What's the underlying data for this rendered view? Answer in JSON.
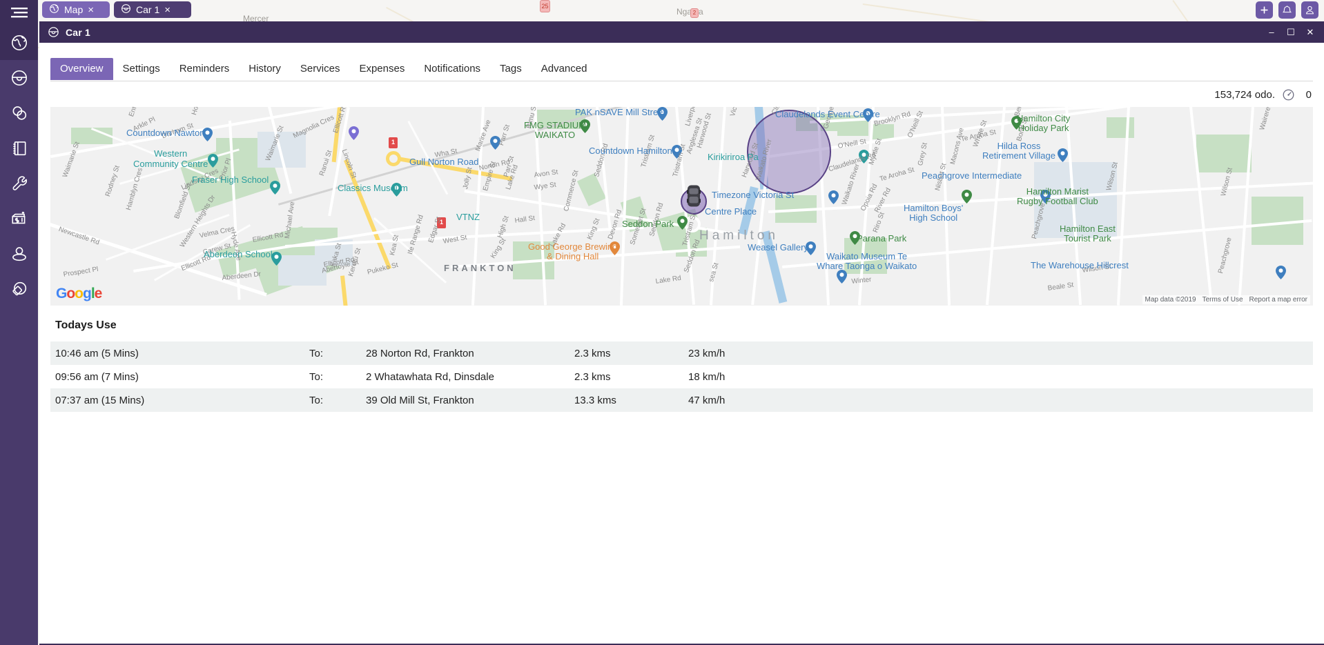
{
  "tabstrip": {
    "tabs": [
      {
        "label": "Map",
        "icon": "globe-icon",
        "close": "×",
        "active": true
      },
      {
        "label": "Car 1",
        "icon": "steering-wheel-icon",
        "close": "×",
        "active": false
      }
    ]
  },
  "topright": {
    "buttons": [
      {
        "name": "add-button",
        "icon": "plus-icon"
      },
      {
        "name": "notifications-button",
        "icon": "bell-icon"
      },
      {
        "name": "account-button",
        "icon": "user-icon"
      }
    ]
  },
  "rail": {
    "menu_icon": "hamburger-menu-icon",
    "items": [
      {
        "icon": "globe-icon",
        "name": "sidebar-item-map",
        "active": true
      },
      {
        "icon": "steering-wheel-icon",
        "name": "sidebar-item-vehicles",
        "active": false
      },
      {
        "icon": "circles-icon",
        "name": "sidebar-item-groups",
        "active": false
      },
      {
        "icon": "notebook-icon",
        "name": "sidebar-item-logbook",
        "active": false
      },
      {
        "icon": "wrench-icon",
        "name": "sidebar-item-services",
        "active": false
      },
      {
        "icon": "money-icon",
        "name": "sidebar-item-expenses",
        "active": false
      },
      {
        "icon": "person-pin-icon",
        "name": "sidebar-item-drivers",
        "active": false
      },
      {
        "icon": "tag-icon",
        "name": "sidebar-item-tags",
        "active": false
      }
    ]
  },
  "window": {
    "title": "Car 1",
    "title_icon": "steering-wheel-icon",
    "controls": {
      "minimize": "–",
      "maximize": "☐",
      "close": "✕"
    }
  },
  "nav": {
    "tabs": [
      {
        "label": "Overview",
        "active": true
      },
      {
        "label": "Settings",
        "active": false
      },
      {
        "label": "Reminders",
        "active": false
      },
      {
        "label": "History",
        "active": false
      },
      {
        "label": "Services",
        "active": false
      },
      {
        "label": "Expenses",
        "active": false
      },
      {
        "label": "Notifications",
        "active": false
      },
      {
        "label": "Tags",
        "active": false
      },
      {
        "label": "Advanced",
        "active": false
      }
    ]
  },
  "odometer": {
    "reading": "153,724 odo.",
    "gauge_icon": "speedometer-icon",
    "gauge_value": "0"
  },
  "map": {
    "provider_logo": "google-logo",
    "attribution": [
      "Map data ©2019",
      "Terms of Use",
      "Report a map error"
    ],
    "city_label": "Hamilton",
    "suburb_label": "FRANKTON",
    "vehicle_marker": "car-marker-icon",
    "geofence_label": "geofence-circle",
    "pois": [
      {
        "name": "Countdown Nawton",
        "kind": "blue"
      },
      {
        "name": "Western\nCommunity Centre",
        "kind": "teal"
      },
      {
        "name": "Fraser High School",
        "kind": "teal"
      },
      {
        "name": "Classics Museum",
        "kind": "teal"
      },
      {
        "name": "Aberdeen School",
        "kind": "teal"
      },
      {
        "name": "Gull Norton Road",
        "kind": "blue"
      },
      {
        "name": "VTNZ",
        "kind": "teal"
      },
      {
        "name": "PAK nSAVE Mill Street",
        "kind": "blue"
      },
      {
        "name": "FMG STADIUM\nWAIKATO",
        "kind": "green"
      },
      {
        "name": "Countdown Hamilton",
        "kind": "blue"
      },
      {
        "name": "Kirikiriroa Pa",
        "kind": "teal"
      },
      {
        "name": "Timezone Victoria St",
        "kind": "blue"
      },
      {
        "name": "Centre Place",
        "kind": "blue"
      },
      {
        "name": "Seddon Park",
        "kind": "green"
      },
      {
        "name": "Good George Brewing\n& Dining Hall",
        "kind": "orange"
      },
      {
        "name": "Weasel Gallery",
        "kind": "blue"
      },
      {
        "name": "Parana Park",
        "kind": "green"
      },
      {
        "name": "Waikato Museum Te\nWhare Taonga o Waikato",
        "kind": "blue"
      },
      {
        "name": "Claudelands Event Centre",
        "kind": "blue"
      },
      {
        "name": "Hamilton City\nHoliday Park",
        "kind": "green"
      },
      {
        "name": "Hilda Ross\nRetirement Village",
        "kind": "blue"
      },
      {
        "name": "Peachgrove Intermediate",
        "kind": "blue"
      },
      {
        "name": "Hamilton Marist\nRugby Football Club",
        "kind": "green"
      },
      {
        "name": "Hamilton Boys'\nHigh School",
        "kind": "blue"
      },
      {
        "name": "Hamilton East\nTourist Park",
        "kind": "green"
      },
      {
        "name": "The Warehouse Hillcrest",
        "kind": "blue"
      }
    ],
    "streets": [
      "Newcastle Rd",
      "Ellicott Rd",
      "Hyde Ave",
      "Rodney St",
      "Hamblyn Cres",
      "Blomfield St",
      "Velma Cres",
      "Carew St",
      "Lindsay Cres",
      "Prior Pl",
      "Western Heights Dr",
      "Prospect Pl",
      "Aberdeen Dr",
      "Michael Ave",
      "Magnolia Cres",
      "Waimarie St",
      "Ranui St",
      "Durham St",
      "Arkle Pl",
      "Holmes St",
      "Enfield",
      "Lincoln St",
      "Aberfoyle St",
      "Pukeko St",
      "Kaka St",
      "Kereru St",
      "West St",
      "High St",
      "Lake Rd",
      "Norton Rd",
      "Wha St",
      "Marire Ave",
      "Parr St",
      "Jolly St",
      "Empire St",
      "Rimu St",
      "Hall St",
      "Avon St",
      "Wye St",
      "Commerce St",
      "Seddon Rd",
      "Tristram St",
      "King St",
      "Devon Rd",
      "Somerset St",
      "Liverpool St",
      "Harwood St",
      "Anglesea St",
      "Victoria St",
      "Clifton Rd",
      "George St",
      "O'Neill St",
      "Claudelands Rd",
      "Myrtle St",
      "Te Aroha St",
      "Grey St",
      "Macons Ave",
      "Whyte St",
      "Bell St",
      "Bond St",
      "River Rd",
      "Opoia Rd",
      "Riro St",
      "Wilson St",
      "Beale St",
      "Nisbet St",
      "Peachgrove",
      "Waikato River",
      "Edgar St",
      "Winter"
    ]
  },
  "trips": {
    "heading": "Todays Use",
    "rows": [
      {
        "time": "10:46 am (5 Mins)",
        "to": "To:",
        "address": "28 Norton Rd, Frankton",
        "distance": "2.3 kms",
        "speed": "23 km/h"
      },
      {
        "time": "09:56 am (7 Mins)",
        "to": "To:",
        "address": "2 Whatawhata Rd, Dinsdale",
        "distance": "2.3 kms",
        "speed": "18 km/h"
      },
      {
        "time": "07:37 am (15 Mins)",
        "to": "To:",
        "address": "39 Old Mill St, Frankton",
        "distance": "13.3 kms",
        "speed": "47 km/h"
      }
    ]
  },
  "colors": {
    "brand_dark": "#3b2d58",
    "brand_rail": "#493a6b",
    "accent": "#7b66b5",
    "row_alt": "#eef1f1"
  }
}
